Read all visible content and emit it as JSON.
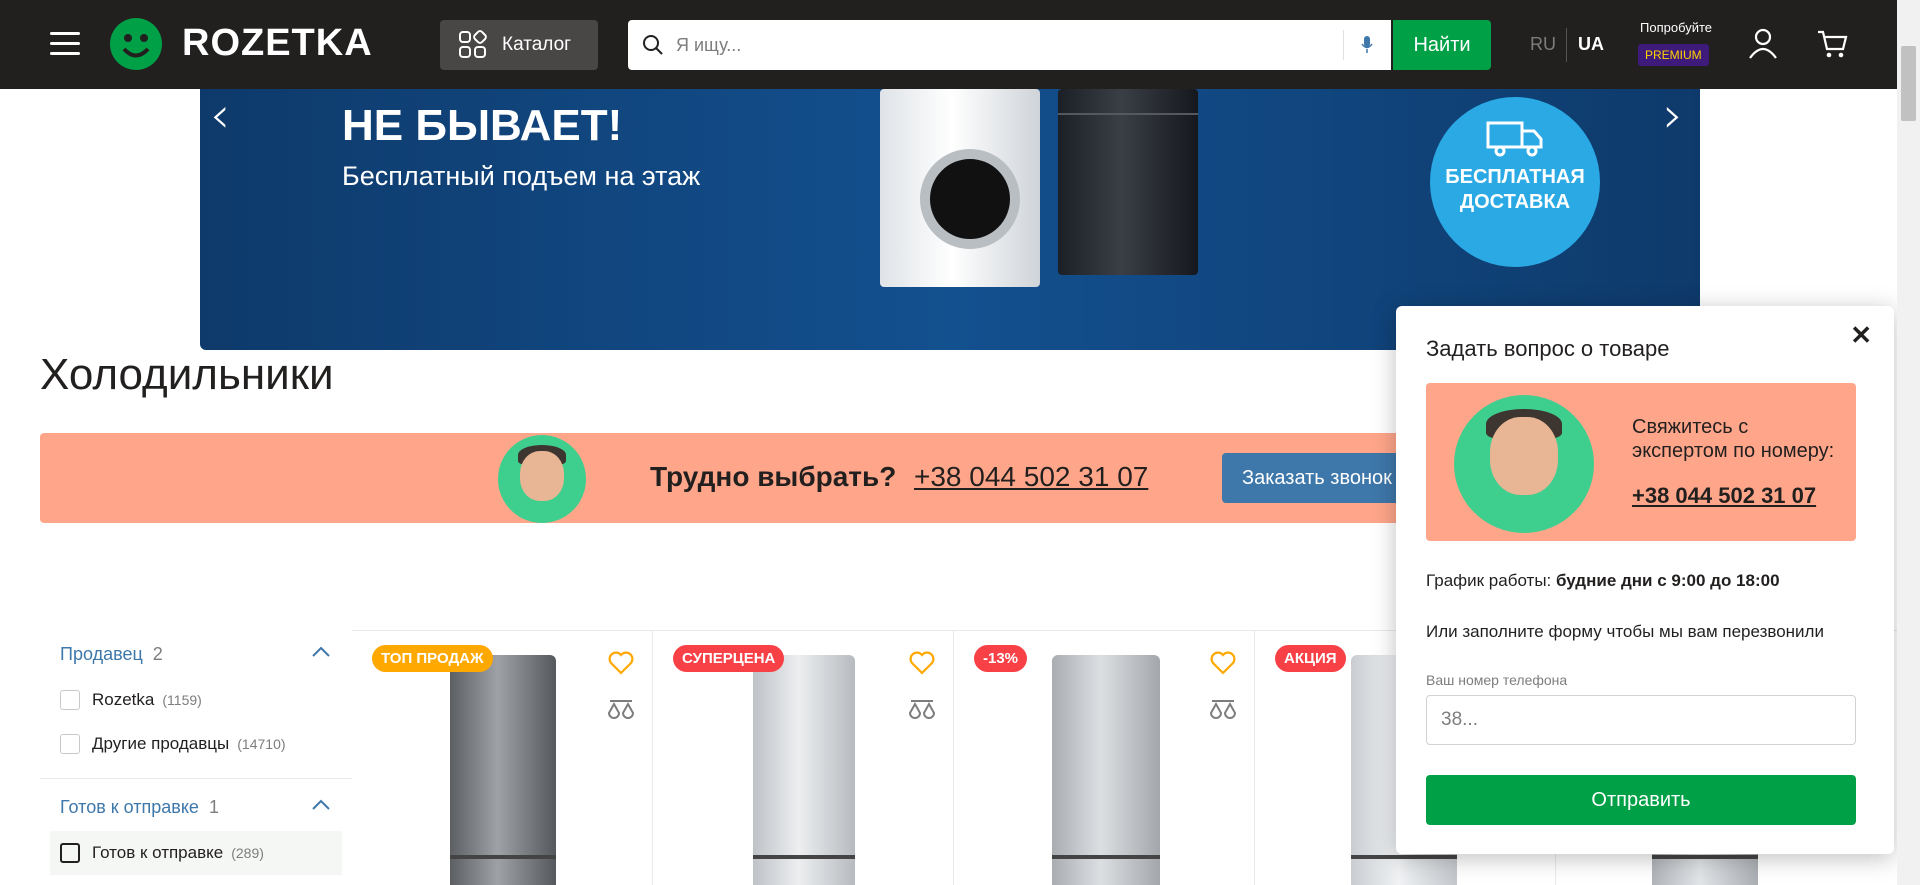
{
  "header": {
    "logo_text": "ROZETKA",
    "catalog_label": "Каталог",
    "search_placeholder": "Я ищу...",
    "search_button": "Найти",
    "lang_ru": "RU",
    "lang_ua": "UA",
    "premium_try": "Попробуйте",
    "premium_badge": "PREMIUM"
  },
  "banner": {
    "title": "НЕ БЫВАЕТ!",
    "subtitle": "Бесплатный подъем на этаж",
    "delivery_line1": "БЕСПЛАТНАЯ",
    "delivery_line2": "ДОСТАВКА"
  },
  "page_title": "Холодильники",
  "expert_strip": {
    "question": "Трудно выбрать?",
    "phone": "+38 044 502 31 07",
    "call_button": "Заказать звонок"
  },
  "filters": [
    {
      "title": "Продавец",
      "count": "2",
      "options": [
        {
          "label": "Rozetka",
          "count": "(1159)"
        },
        {
          "label": "Другие продавцы",
          "count": "(14710)"
        }
      ]
    },
    {
      "title": "Готов к отправке",
      "count": "1",
      "options": [
        {
          "label": "Готов к отправке",
          "count": "(289)"
        }
      ]
    }
  ],
  "products": [
    {
      "badge": "ТОП ПРОДАЖ",
      "badge_color": "#ffa900"
    },
    {
      "badge": "СУПЕРЦЕНА",
      "badge_color": "#f84147"
    },
    {
      "badge": "-13%",
      "badge_color": "#f84147"
    },
    {
      "badge": "АКЦИЯ",
      "badge_color": "#f84147"
    }
  ],
  "modal": {
    "title": "Задать вопрос о товаре",
    "contact_text": "Свяжитесь с экспертом по номеру:",
    "phone": "+38 044 502 31 07",
    "hours_label": "График работы:",
    "hours_value": "будние дни с 9:00 до 18:00",
    "form_hint": "Или заполните форму чтобы мы вам перезвонили",
    "phone_label": "Ваш номер телефона",
    "phone_placeholder": "38...",
    "send_button": "Отправить"
  },
  "colors": {
    "header_bg": "#221f1f",
    "accent_green": "#00a046",
    "link_blue": "#3e77aa",
    "expert_bg": "#ffa68a"
  }
}
